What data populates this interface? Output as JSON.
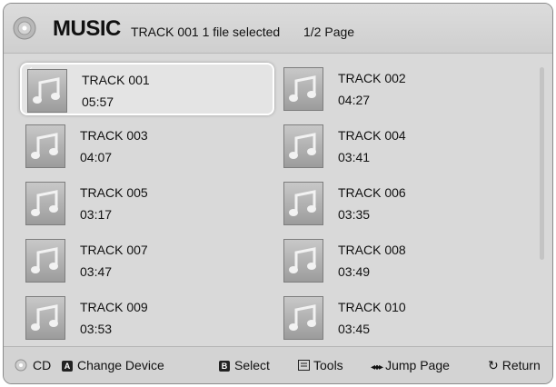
{
  "header": {
    "title": "MUSIC",
    "subtitle": "TRACK 001 1 file selected",
    "page": "1/2 Page"
  },
  "tracks": [
    {
      "name": "TRACK 001",
      "time": "05:57"
    },
    {
      "name": "TRACK 002",
      "time": "04:27"
    },
    {
      "name": "TRACK 003",
      "time": "04:07"
    },
    {
      "name": "TRACK 004",
      "time": "03:41"
    },
    {
      "name": "TRACK 005",
      "time": "03:17"
    },
    {
      "name": "TRACK 006",
      "time": "03:35"
    },
    {
      "name": "TRACK 007",
      "time": "03:47"
    },
    {
      "name": "TRACK 008",
      "time": "03:49"
    },
    {
      "name": "TRACK 009",
      "time": "03:53"
    },
    {
      "name": "TRACK 010",
      "time": "03:45"
    }
  ],
  "footer": {
    "device": "CD",
    "change_device_key": "A",
    "change_device": "Change Device",
    "select_key": "B",
    "select": "Select",
    "tools": "Tools",
    "jump_page": "Jump Page",
    "return": "Return"
  }
}
